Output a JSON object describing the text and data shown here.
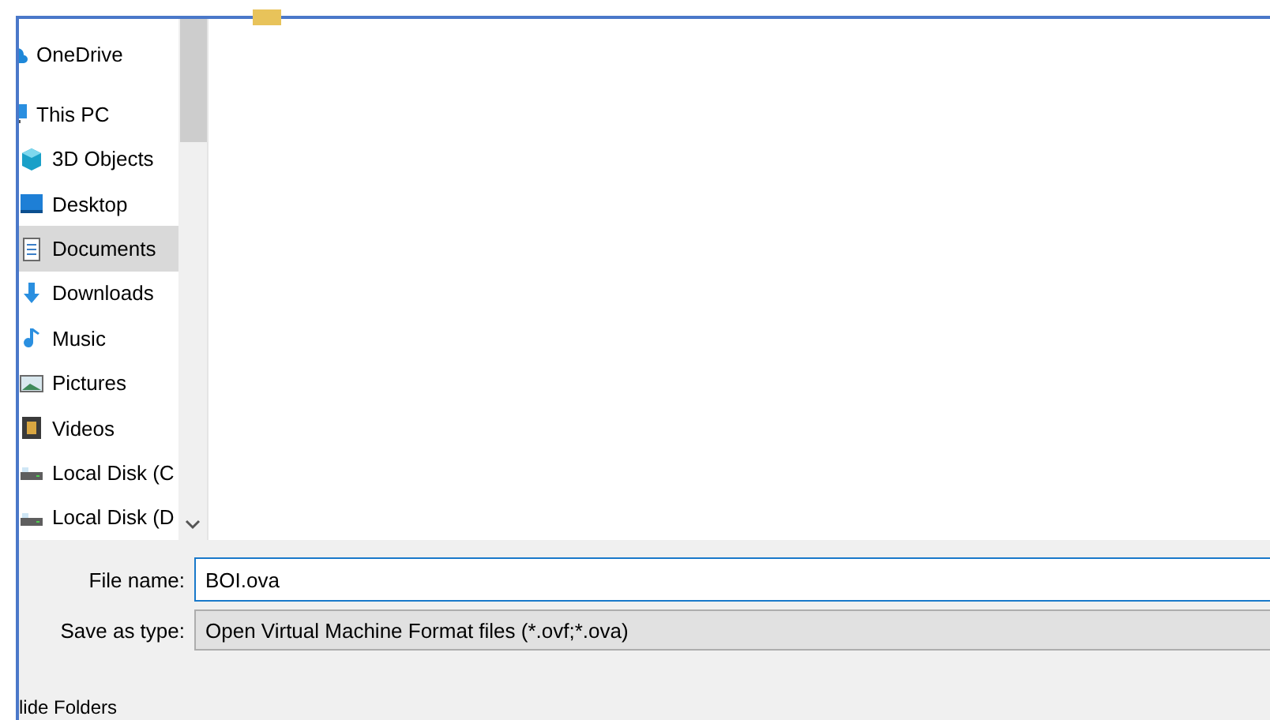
{
  "nav_pane": {
    "items": [
      {
        "label": "OneDrive",
        "selected": false
      },
      {
        "label": "This PC",
        "selected": false,
        "children": [
          {
            "label": "3D Objects",
            "selected": false
          },
          {
            "label": "Desktop",
            "selected": false
          },
          {
            "label": "Documents",
            "selected": true
          },
          {
            "label": "Downloads",
            "selected": false
          },
          {
            "label": "Music",
            "selected": false
          },
          {
            "label": "Pictures",
            "selected": false
          },
          {
            "label": "Videos",
            "selected": false
          },
          {
            "label": "Local Disk (C",
            "selected": false
          },
          {
            "label": "Local Disk (D",
            "selected": false
          }
        ]
      }
    ]
  },
  "form": {
    "file_name": {
      "label": "File name:",
      "value": "BOI.ova"
    },
    "save_as_type": {
      "label": "Save as type:",
      "value": "Open Virtual Machine Format files (*.ovf;*.ova)"
    }
  },
  "hide_folders": "lide Folders"
}
